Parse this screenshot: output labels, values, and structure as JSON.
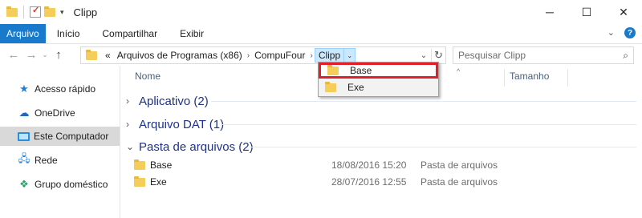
{
  "window": {
    "title": "Clipp",
    "controls": {
      "minimize": "─",
      "maximize": "☐",
      "close": "✕"
    }
  },
  "quick_access": {
    "dropdown_glyph": "▾"
  },
  "ribbon": {
    "file_tab": "Arquivo",
    "tabs": [
      "Início",
      "Compartilhar",
      "Exibir"
    ],
    "collapse_glyph": "⌄",
    "help_glyph": "?"
  },
  "address": {
    "overflow": "«",
    "crumbs": [
      "Arquivos de Programas (x86)",
      "CompuFour",
      "Clipp"
    ],
    "separator": "›",
    "drop_glyph": "⌄",
    "refresh_glyph": "↻"
  },
  "search": {
    "placeholder": "Pesquisar Clipp",
    "icon_glyph": "⌕"
  },
  "nav": {
    "back": "←",
    "forward": "→",
    "recent": "⌄",
    "up": "↑",
    "items": [
      {
        "label": "Acesso rápido",
        "icon": "star-icon",
        "glyph": "★"
      },
      {
        "label": "OneDrive",
        "icon": "cloud-icon",
        "glyph": "☁"
      },
      {
        "label": "Este Computador",
        "icon": "computer-icon",
        "glyph": ""
      },
      {
        "label": "Rede",
        "icon": "network-icon",
        "glyph": "🖧"
      },
      {
        "label": "Grupo doméstico",
        "icon": "homegroup-icon",
        "glyph": "❖"
      }
    ],
    "selected_index": 2
  },
  "columns": {
    "name": "Nome",
    "size": "Tamanho",
    "sort_glyph": "^"
  },
  "groups": [
    {
      "label": "Aplicativo (2)",
      "expanded": false,
      "chevron": "›"
    },
    {
      "label": "Arquivo DAT (1)",
      "expanded": false,
      "chevron": "›"
    },
    {
      "label": "Pasta de arquivos (2)",
      "expanded": true,
      "chevron": "⌄"
    }
  ],
  "files": [
    {
      "name": "Base",
      "date": "18/08/2016 15:20",
      "type": "Pasta de arquivos"
    },
    {
      "name": "Exe",
      "date": "28/07/2016 12:55",
      "type": "Pasta de arquivos"
    }
  ],
  "dropdown": {
    "items": [
      "Base",
      "Exe"
    ],
    "highlighted_index": 0,
    "highlight_color": "#e3202a"
  },
  "colors": {
    "accent": "#1979ca",
    "group_text": "#1e3287",
    "selection": "#cce8ff"
  }
}
